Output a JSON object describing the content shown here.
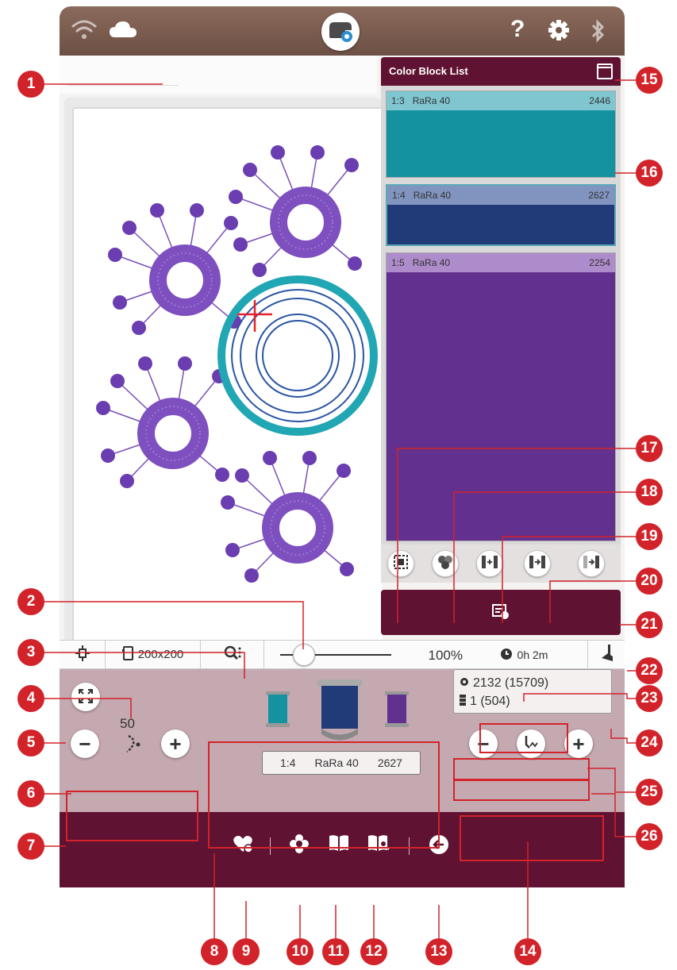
{
  "colors": {
    "accent": "#5f1231",
    "topbar": "#7a5a4d",
    "panel": "#c5a9b0",
    "callout": "#d2232a",
    "teal": "#14929f",
    "navy": "#213a78",
    "purple": "#62318f"
  },
  "topbar": {
    "icons": [
      "wifi-icon",
      "cloud-icon",
      "embroidery-machine-icon",
      "help-icon",
      "settings-icon",
      "bluetooth-icon"
    ],
    "help_label": "?"
  },
  "color_block_list": {
    "title": "Color Block List",
    "blocks": [
      {
        "id": "1:3",
        "thread": "RaRa 40",
        "count": "2446",
        "color": "#14929f",
        "header_color": "#7fc6d0"
      },
      {
        "id": "1:4",
        "thread": "RaRa 40",
        "count": "2627",
        "color": "#213a78",
        "header_color": "#8094bf"
      },
      {
        "id": "1:5",
        "thread": "RaRa 40",
        "count": "2254",
        "color": "#62318f",
        "header_color": "#ae8ccb"
      }
    ],
    "tools": [
      "frame-icon",
      "color-groups-icon",
      "merge-icon",
      "split-before-icon",
      "split-after-icon"
    ]
  },
  "toolbar": {
    "hoop_size": "200x200",
    "zoom": "100%",
    "time": "0h 2m"
  },
  "panel": {
    "speed_value": "50",
    "thread": {
      "id": "1:4",
      "name": "RaRa 40",
      "count": "2627"
    },
    "stitch_count": "2132 (15709)",
    "color_block_count": "1 (504)"
  },
  "nav": {
    "icons": [
      "favorites-icon",
      "design-library-icon",
      "book-icon",
      "book-search-icon",
      "back-icon"
    ]
  },
  "callouts": [
    "1",
    "2",
    "3",
    "4",
    "5",
    "6",
    "7",
    "8",
    "9",
    "10",
    "11",
    "12",
    "13",
    "14",
    "15",
    "16",
    "17",
    "18",
    "19",
    "20",
    "21",
    "22",
    "23",
    "24",
    "25",
    "26"
  ]
}
